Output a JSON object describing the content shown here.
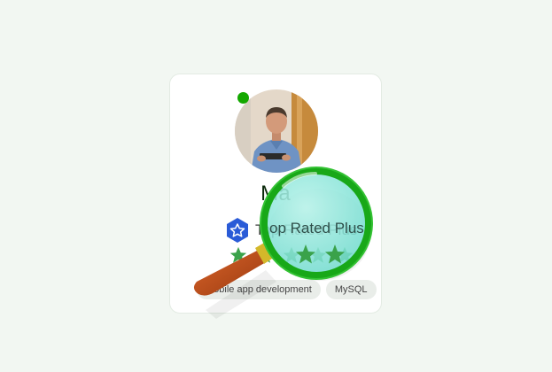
{
  "profile": {
    "name": "Ma",
    "badge_label": "Top Rated Plus",
    "rating_stars": 5,
    "online": true
  },
  "skills": [
    "Mobile app development",
    "MySQL"
  ],
  "colors": {
    "background": "#f2f7f2",
    "online_green": "#14a800",
    "badge_blue": "#2a5bd7",
    "star_green": "#3aa24a",
    "lens_rim": "#1db31d",
    "lens_glass": "#8ee8dd",
    "handle": "#c0501a"
  },
  "icons": [
    "online-status-dot",
    "top-rated-badge-icon",
    "star-icon",
    "magnifying-glass-icon"
  ]
}
